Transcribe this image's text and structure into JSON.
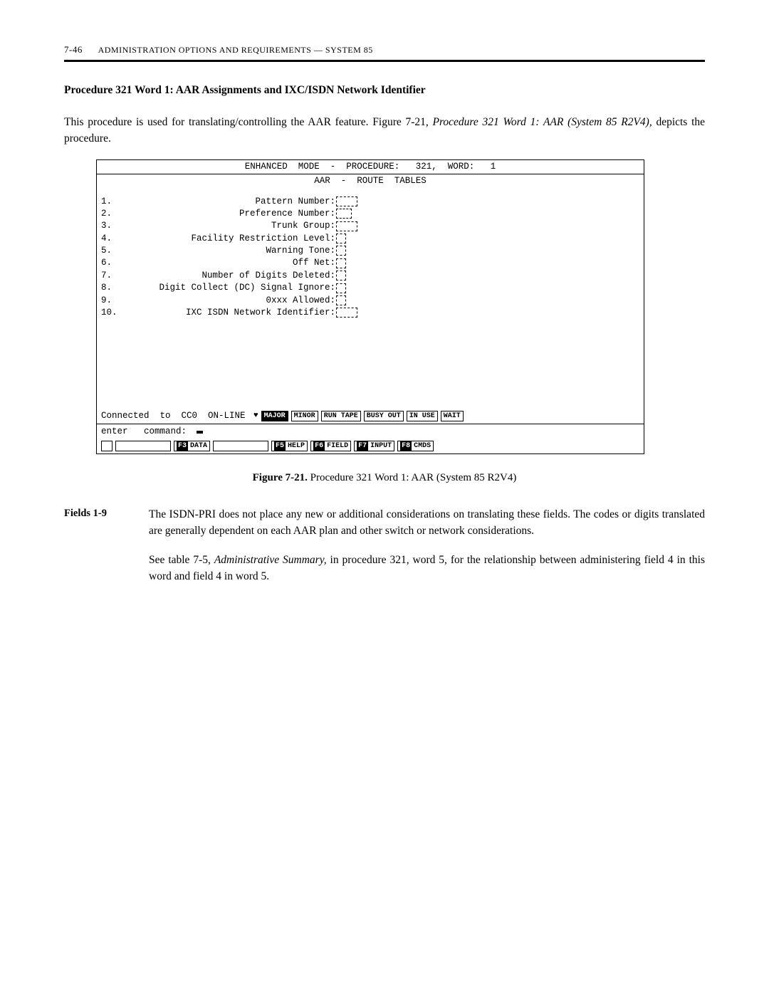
{
  "header": {
    "page_number": "7-46",
    "title": "ADMINISTRATION  OPTIONS  AND  REQUIREMENTS  —  SYSTEM  85"
  },
  "section": {
    "title": "Procedure 321 Word 1: AAR Assignments and IXC/ISDN Network Identifier",
    "intro_pre": "This  procedure  is  used  for  translating/controlling  the  AAR  feature.  Figure  7-21,  ",
    "intro_ital": "Procedure  321  Word 1: AAR (System 85 R2V4),",
    "intro_post": " depicts  the  procedure."
  },
  "terminal": {
    "top_line": "ENHANCED  MODE  -  PROCEDURE:   321,  WORD:   1",
    "subtitle": "AAR  -  ROUTE  TABLES",
    "fields": [
      {
        "n": "1.",
        "label": "Pattern  Number:",
        "box": "db3"
      },
      {
        "n": "2.",
        "label": "Preference  Number:",
        "box": "db2"
      },
      {
        "n": "3.",
        "label": "Trunk  Group:",
        "box": "db3"
      },
      {
        "n": "4.",
        "label": "Facility  Restriction  Level:",
        "box": "db1"
      },
      {
        "n": "5.",
        "label": "Warning  Tone:",
        "box": "db1"
      },
      {
        "n": "6.",
        "label": "Off  Net:",
        "box": "db1"
      },
      {
        "n": "7.",
        "label": "Number  of  Digits  Deleted:",
        "box": "db1"
      },
      {
        "n": "8.",
        "label": "Digit  Collect  (DC)  Signal  Ignore:",
        "box": "db1"
      },
      {
        "n": "9.",
        "label": "0xxx  Allowed:",
        "box": "db1"
      },
      {
        "n": "10.",
        "label": "IXC  ISDN  Network  Identifier:",
        "box": "db3"
      }
    ],
    "status": {
      "text": "Connected  to  CC0  ON-LINE ",
      "chips": [
        "MAJOR",
        "MINOR",
        "RUN TAPE",
        "BUSY OUT",
        "IN USE",
        "WAIT"
      ]
    },
    "cmd": {
      "label": "enter   command: "
    },
    "fkeys": {
      "f3": "DATA",
      "f5": "HELP",
      "f6": "FIELD",
      "f7": "INPUT",
      "f8": "CMDS"
    }
  },
  "caption": {
    "bold": "Figure 7-21.",
    "rest": " Procedure  321  Word  1:  AAR  (System  85  R2V4)"
  },
  "desc": {
    "label": "Fields 1-9",
    "p1": "The  ISDN-PRI  does  not  place  any  new  or  additional  considerations  on  translating these  fields.  The  codes  or  digits  translated  are  generally  dependent  on  each  AAR plan  and  other  switch  or  network  considerations.",
    "p2_pre": "See  table  7-5,  ",
    "p2_ital": "Administrative  Summary,",
    "p2_post": "  in  procedure  321,  word  5,  for  the relationship  between  administering  field  4  in  this  word  and  field  4  in  word  5."
  }
}
